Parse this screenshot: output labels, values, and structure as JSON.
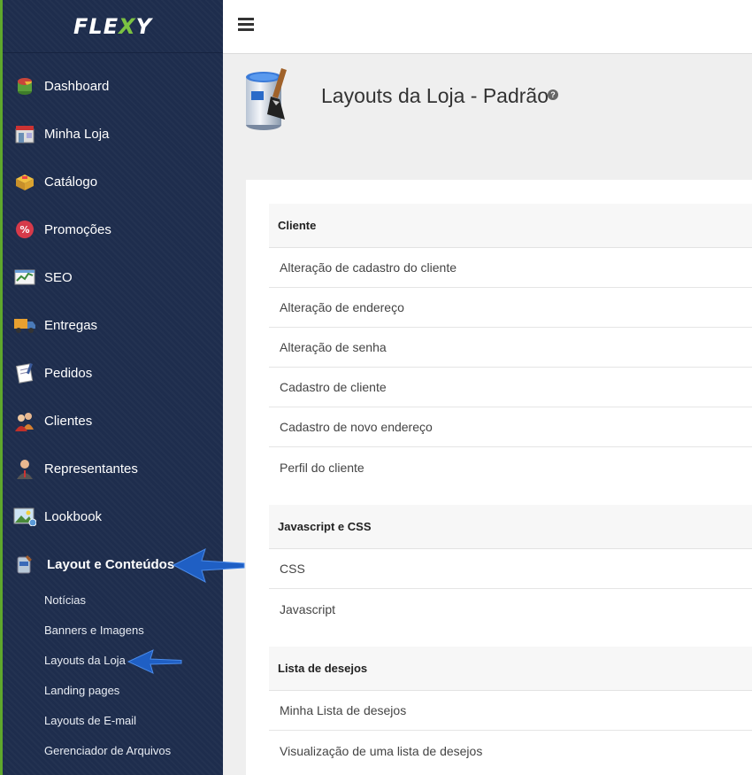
{
  "sidebar": {
    "logo": {
      "part1": "FLE",
      "part2": "X",
      "part3": "Y"
    },
    "items": [
      {
        "label": "Dashboard",
        "icon": "dashboard-icon"
      },
      {
        "label": "Minha Loja",
        "icon": "store-icon"
      },
      {
        "label": "Catálogo",
        "icon": "catalog-box-icon"
      },
      {
        "label": "Promoções",
        "icon": "promo-percent-icon"
      },
      {
        "label": "SEO",
        "icon": "seo-chart-icon"
      },
      {
        "label": "Entregas",
        "icon": "delivery-truck-icon"
      },
      {
        "label": "Pedidos",
        "icon": "orders-notepad-icon"
      },
      {
        "label": "Clientes",
        "icon": "clients-users-icon"
      },
      {
        "label": "Representantes",
        "icon": "representative-user-icon"
      },
      {
        "label": "Lookbook",
        "icon": "lookbook-image-icon"
      },
      {
        "label": "Layout e Conteúdos",
        "icon": "layout-content-icon"
      }
    ],
    "submenu": [
      {
        "label": "Notícias"
      },
      {
        "label": "Banners e Imagens"
      },
      {
        "label": "Layouts da Loja"
      },
      {
        "label": "Landing pages"
      },
      {
        "label": "Layouts de E-mail"
      },
      {
        "label": "Gerenciador de Arquivos"
      }
    ]
  },
  "header": {
    "title": "Layouts da Loja - Padrão",
    "help": "?"
  },
  "sections": [
    {
      "title": "Cliente",
      "rows": [
        "Alteração de cadastro do cliente",
        "Alteração de endereço",
        "Alteração de senha",
        "Cadastro de cliente",
        "Cadastro de novo endereço",
        "Perfil do cliente"
      ]
    },
    {
      "title": "Javascript e CSS",
      "rows": [
        "CSS",
        "Javascript"
      ]
    },
    {
      "title": "Lista de desejos",
      "rows": [
        "Minha Lista de desejos",
        "Visualização de uma lista de desejos"
      ]
    }
  ],
  "colors": {
    "sidebar_bg": "#1e2d4d",
    "accent_green": "#7cc242",
    "arrow_blue": "#1f5fc4"
  }
}
